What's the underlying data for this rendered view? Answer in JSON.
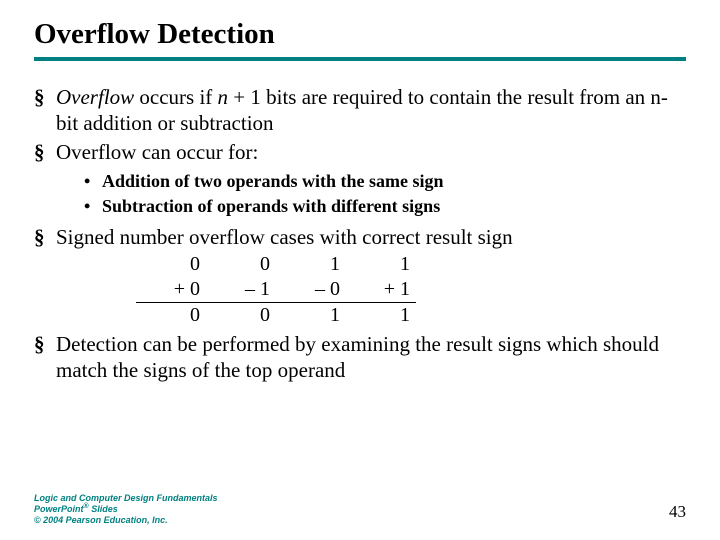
{
  "title": "Overflow Detection",
  "bullets": {
    "b1_prefix_italic": "Overflow",
    "b1_rest_a": " occurs if ",
    "b1_italic_n": "n",
    "b1_rest_b": " + 1 bits are required to contain the result from an n-bit addition or subtraction",
    "b2": "Overflow can occur for:",
    "b2_sub_a": "Addition of two operands with the same sign",
    "b2_sub_b": "Subtraction of operands with different signs",
    "b3": "Signed number overflow cases with correct result sign",
    "b4": "Detection can be performed by examining the result signs which should match the signs of the top operand"
  },
  "chart_data": {
    "type": "table",
    "title": "Signed number overflow cases with correct result sign",
    "columns": [
      "case1",
      "case2",
      "case3",
      "case4"
    ],
    "rows": [
      {
        "label": "top_operand",
        "values": [
          "0",
          "0",
          "1",
          "1"
        ]
      },
      {
        "label": "bottom_operand",
        "values": [
          "+ 0",
          "– 1",
          "– 0",
          "+ 1"
        ]
      },
      {
        "label": "result",
        "values": [
          "0",
          "0",
          "1",
          "1"
        ]
      }
    ]
  },
  "cases": {
    "r1": {
      "c1": "0",
      "c2": "0",
      "c3": "1",
      "c4": "1"
    },
    "r2": {
      "c1": "+ 0",
      "c2": "– 1",
      "c3": "– 0",
      "c4": "+ 1"
    },
    "r3": {
      "c1": "0",
      "c2": "0",
      "c3": "1",
      "c4": "1"
    }
  },
  "footer": {
    "line1a": "Logic and Computer Design Fundamentals",
    "line2a": "PowerPoint",
    "line2sup": "®",
    "line2b": " Slides",
    "line3": "© 2004 Pearson Education, Inc."
  },
  "page_number": "43"
}
